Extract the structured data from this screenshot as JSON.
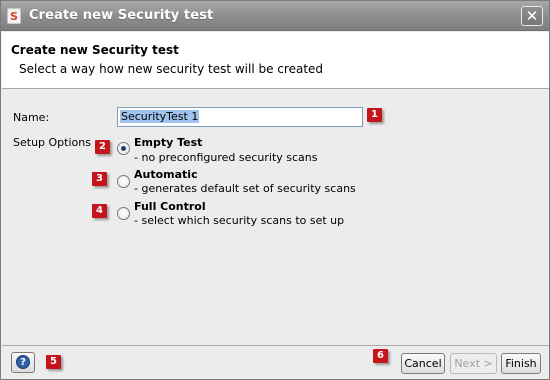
{
  "window": {
    "title": "Create new Security test",
    "app_icon": "soapui-icon",
    "close_icon": "close-x-icon",
    "close_glyph": "✕"
  },
  "header": {
    "title": "Create new Security test",
    "subtitle": "Select a way how new security test will be created"
  },
  "form": {
    "name_label": "Name:",
    "name_value": "SecurityTest 1",
    "setup_label": "Setup Options",
    "options": [
      {
        "title": "Empty Test",
        "description": "- no preconfigured security scans",
        "selected": true
      },
      {
        "title": "Automatic",
        "description": "- generates default set of security scans",
        "selected": false
      },
      {
        "title": "Full Control",
        "description": "- select which security scans to set up",
        "selected": false
      }
    ]
  },
  "markers": [
    "1",
    "2",
    "3",
    "4",
    "5",
    "6"
  ],
  "footer": {
    "help_icon": "help-question-icon",
    "help_glyph": "?",
    "cancel_label": "Cancel",
    "next_label": "Next >",
    "finish_label": "Finish"
  },
  "colors": {
    "marker_red": "#c4151c",
    "selection_blue": "#9fc3ec"
  }
}
